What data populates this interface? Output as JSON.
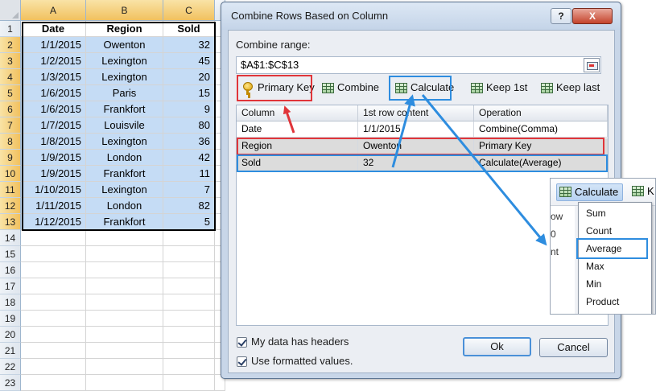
{
  "spreadsheet": {
    "columns": [
      "A",
      "B",
      "C"
    ],
    "row_numbers": [
      "1",
      "2",
      "3",
      "4",
      "5",
      "6",
      "7",
      "8",
      "9",
      "10",
      "11",
      "12",
      "13",
      "14",
      "15",
      "16",
      "17",
      "18",
      "19",
      "20",
      "21",
      "22",
      "23"
    ],
    "headers": [
      "Date",
      "Region",
      "Sold"
    ],
    "rows": [
      [
        "1/1/2015",
        "Owenton",
        "32"
      ],
      [
        "1/2/2015",
        "Lexington",
        "45"
      ],
      [
        "1/3/2015",
        "Lexington",
        "20"
      ],
      [
        "1/6/2015",
        "Paris",
        "15"
      ],
      [
        "1/6/2015",
        "Frankfort",
        "9"
      ],
      [
        "1/7/2015",
        "Louisvile",
        "80"
      ],
      [
        "1/8/2015",
        "Lexington",
        "36"
      ],
      [
        "1/9/2015",
        "London",
        "42"
      ],
      [
        "1/9/2015",
        "Frankfort",
        "11"
      ],
      [
        "1/10/2015",
        "Lexington",
        "7"
      ],
      [
        "1/11/2015",
        "London",
        "82"
      ],
      [
        "1/12/2015",
        "Frankfort",
        "5"
      ]
    ]
  },
  "dialog": {
    "title": "Combine Rows Based on Column",
    "help_label": "?",
    "close_label": "X",
    "combine_range_label": "Combine range:",
    "combine_range_value": "$A$1:$C$13",
    "toolbar": {
      "primary_key": "Primary Key",
      "combine": "Combine",
      "calculate": "Calculate",
      "keep_first": "Keep 1st",
      "keep_last": "Keep last"
    },
    "grid": {
      "headers": [
        "Column",
        "1st row content",
        "Operation"
      ],
      "rows": [
        [
          "Date",
          "1/1/2015",
          "Combine(Comma)"
        ],
        [
          "Region",
          "Owenton",
          "Primary Key"
        ],
        [
          "Sold",
          "32",
          "Calculate(Average)"
        ]
      ]
    },
    "my_data_has_headers": "My data has headers",
    "use_formatted_values": "Use formatted values.",
    "ok_label": "Ok",
    "cancel_label": "Cancel"
  },
  "popup": {
    "calculate_label": "Calculate",
    "partial_button_label": "K",
    "ghost_texts": [
      "ow",
      "0",
      "nt"
    ],
    "menu_items": [
      "Sum",
      "Count",
      "Average",
      "Max",
      "Min",
      "Product"
    ],
    "highlighted_item": "Average"
  },
  "annotation_colors": {
    "red": "#e0353a",
    "blue": "#2e8ddf"
  }
}
